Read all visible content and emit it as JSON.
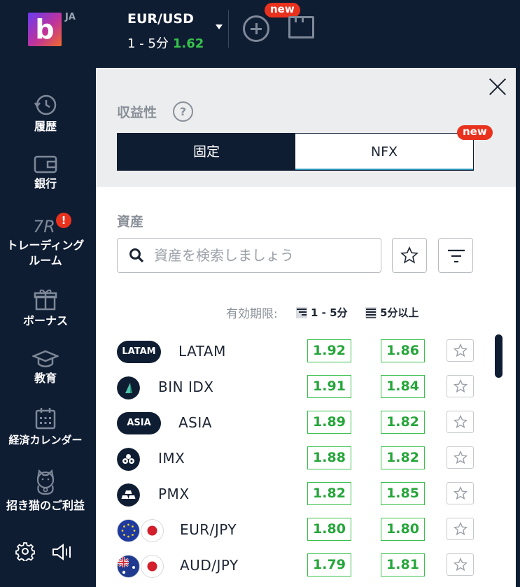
{
  "header": {
    "logo_letter": "b",
    "language": "JA",
    "asset": "EUR/USD",
    "expiry": "1 - 5分",
    "payout": "1.62",
    "new_badge": "new"
  },
  "sidebar": {
    "items": [
      {
        "label": "履歴",
        "icon": "history-icon"
      },
      {
        "label": "銀行",
        "icon": "wallet-icon"
      },
      {
        "label": "トレーディング ルーム",
        "label_line1": "トレーディング",
        "label_line2": "ルーム",
        "icon": "trading-room-icon",
        "badge": "!"
      },
      {
        "label": "ボーナス",
        "icon": "gift-icon"
      },
      {
        "label": "教育",
        "icon": "graduation-cap-icon"
      },
      {
        "label": "経済カレンダー",
        "icon": "calendar-icon"
      },
      {
        "label": "招き猫のご利益",
        "icon": "lucky-cat-icon"
      }
    ],
    "bottom": [
      "settings-gear-icon",
      "sound-icon"
    ]
  },
  "panel": {
    "profitability_label": "収益性",
    "help_mark": "?",
    "toggle": {
      "fixed": "固定",
      "nfx": "NFX",
      "active": "fixed",
      "new_badge": "new"
    },
    "assets_label": "資産",
    "search_placeholder": "資産を検索しましょう",
    "expiry_label": "有効期限:",
    "expiry_short": "1 - 5分",
    "expiry_long": "5分以上",
    "rows": [
      {
        "tag": "LATAM",
        "name": "LATAM",
        "payout_short": "1.92",
        "payout_long": "1.86"
      },
      {
        "tag": "",
        "name": "BIN IDX",
        "payout_short": "1.91",
        "payout_long": "1.84"
      },
      {
        "tag": "ASIA",
        "name": "ASIA",
        "payout_short": "1.89",
        "payout_long": "1.82"
      },
      {
        "tag": "",
        "name": "IMX",
        "payout_short": "1.88",
        "payout_long": "1.82"
      },
      {
        "tag": "",
        "name": "PMX",
        "payout_short": "1.82",
        "payout_long": "1.85"
      },
      {
        "tag": "",
        "name": "EUR/JPY",
        "payout_short": "1.80",
        "payout_long": "1.80"
      },
      {
        "tag": "",
        "name": "AUD/JPY",
        "payout_short": "1.79",
        "payout_long": "1.81"
      }
    ]
  },
  "colors": {
    "navy": "#0f1d33",
    "green": "#37c24a",
    "red_badge": "#e8321e"
  }
}
